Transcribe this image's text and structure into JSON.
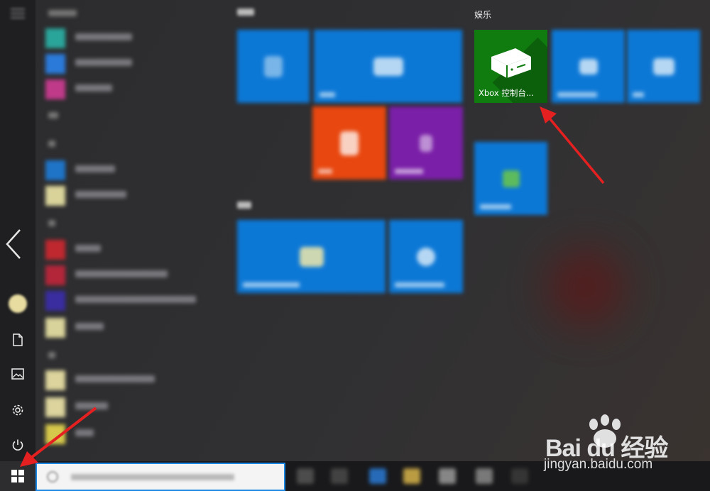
{
  "start_menu": {
    "tile_groups": [
      {
        "label": "娱乐"
      }
    ],
    "xbox_tile": {
      "label": "Xbox 控制台...",
      "color": "#107C10",
      "icon": "xbox-console-icon"
    },
    "accent_color": "#0C78D6"
  },
  "left_rail": {
    "icons": [
      "menu-icon",
      "avatar",
      "documents-icon",
      "pictures-icon",
      "settings-icon",
      "power-icon"
    ],
    "back_icon": "chevron-left-icon"
  },
  "taskbar": {
    "start_icon": "windows-logo-icon"
  },
  "watermark": {
    "brand": "Bai du 经验",
    "url": "jingyan.baidu.com"
  },
  "annotations": {
    "arrow_color": "#E52020",
    "arrows": [
      "arrow-to-xbox-tile",
      "arrow-to-start-button"
    ]
  }
}
